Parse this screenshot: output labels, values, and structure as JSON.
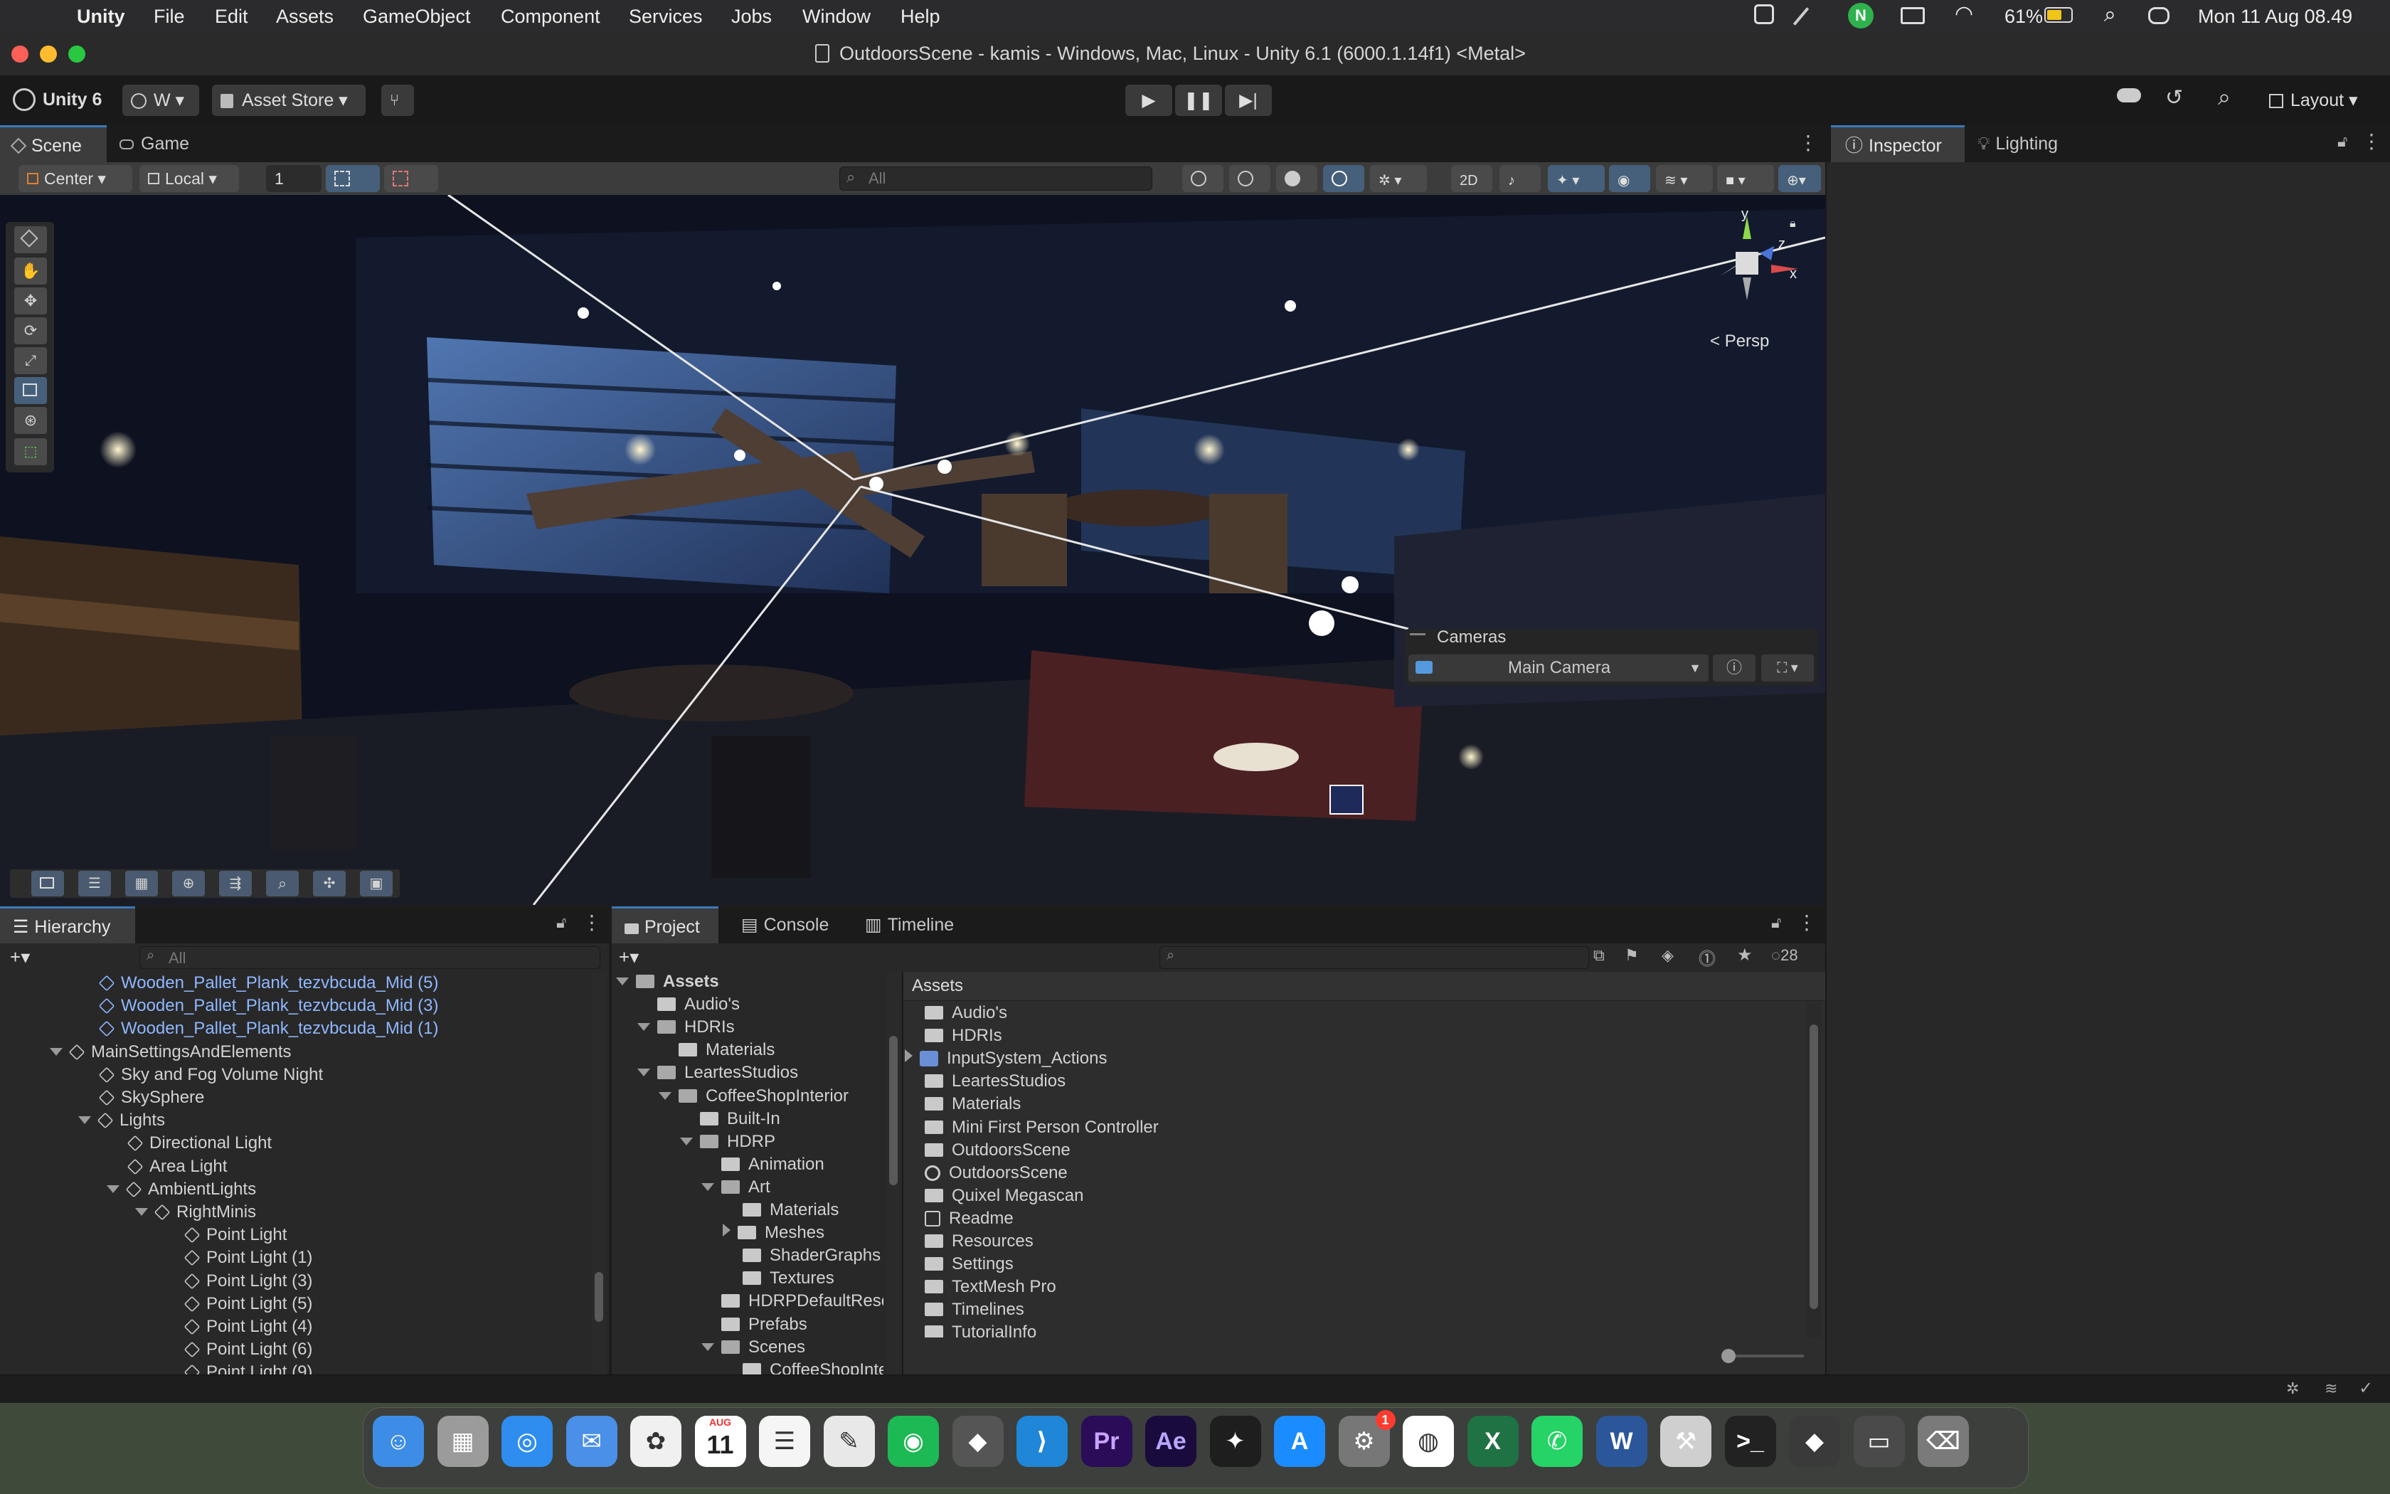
{
  "menubar": {
    "app": "Unity",
    "items": [
      "File",
      "Edit",
      "Assets",
      "GameObject",
      "Component",
      "Services",
      "Jobs",
      "Window",
      "Help"
    ],
    "battery": "61%",
    "clock": "Mon 11 Aug  08.49"
  },
  "window": {
    "title": "OutdoorsScene - kamis - Windows, Mac, Linux - Unity 6.1 (6000.1.14f1) <Metal>"
  },
  "toolbar": {
    "brand": "Unity 6",
    "account": "W",
    "asset_store": "Asset Store",
    "layout": "Layout"
  },
  "scene_tabs": {
    "scene": "Scene",
    "game": "Game"
  },
  "scene_toolbar": {
    "pivot": "Center",
    "space": "Local",
    "grid_value": "1",
    "search_placeholder": "All"
  },
  "scene_view": {
    "persp": "Persp",
    "gizmo_y": "y",
    "gizmo_x": "x",
    "gizmo_z": "z",
    "cameras_title": "Cameras",
    "camera_selected": "Main Camera"
  },
  "inspector_tabs": {
    "inspector": "Inspector",
    "lighting": "Lighting"
  },
  "hierarchy": {
    "title": "Hierarchy",
    "search_placeholder": "All",
    "rows": [
      {
        "label": "Wooden_Pallet_Plank_tezvbcuda_Mid (5)",
        "indent": 1,
        "blue": true
      },
      {
        "label": "Wooden_Pallet_Plank_tezvbcuda_Mid (3)",
        "indent": 1,
        "blue": true
      },
      {
        "label": "Wooden_Pallet_Plank_tezvbcuda_Mid (1)",
        "indent": 1,
        "blue": true
      },
      {
        "label": "MainSettingsAndElements",
        "indent": 0,
        "expanded": true
      },
      {
        "label": "Sky and Fog Volume Night",
        "indent": 1
      },
      {
        "label": "SkySphere",
        "indent": 1
      },
      {
        "label": "Lights",
        "indent": 1,
        "expanded": true
      },
      {
        "label": "Directional Light",
        "indent": 2
      },
      {
        "label": "Area Light",
        "indent": 2
      },
      {
        "label": "AmbientLights",
        "indent": 2,
        "expanded": true
      },
      {
        "label": "RightMinis",
        "indent": 3,
        "expanded": true
      },
      {
        "label": "Point Light",
        "indent": 4
      },
      {
        "label": "Point Light (1)",
        "indent": 4
      },
      {
        "label": "Point Light (3)",
        "indent": 4
      },
      {
        "label": "Point Light (5)",
        "indent": 4
      },
      {
        "label": "Point Light (4)",
        "indent": 4
      },
      {
        "label": "Point Light (6)",
        "indent": 4
      },
      {
        "label": "Point Light (9)",
        "indent": 4
      }
    ]
  },
  "project_tabs": {
    "project": "Project",
    "console": "Console",
    "timeline": "Timeline",
    "hidden_count": "28"
  },
  "project_tree": [
    {
      "label": "Assets",
      "indent": 0,
      "expanded": true,
      "bold": true
    },
    {
      "label": "Audio's",
      "indent": 1
    },
    {
      "label": "HDRIs",
      "indent": 1,
      "expanded": true
    },
    {
      "label": "Materials",
      "indent": 2
    },
    {
      "label": "LeartesStudios",
      "indent": 1,
      "expanded": true
    },
    {
      "label": "CoffeeShopInterior",
      "indent": 2,
      "expanded": true
    },
    {
      "label": "Built-In",
      "indent": 3
    },
    {
      "label": "HDRP",
      "indent": 3,
      "expanded": true
    },
    {
      "label": "Animation",
      "indent": 4
    },
    {
      "label": "Art",
      "indent": 4,
      "expanded": true
    },
    {
      "label": "Materials",
      "indent": 5
    },
    {
      "label": "Meshes",
      "indent": 5,
      "collapsed": true
    },
    {
      "label": "ShaderGraphs",
      "indent": 5
    },
    {
      "label": "Textures",
      "indent": 5
    },
    {
      "label": "HDRPDefaultReso",
      "indent": 4
    },
    {
      "label": "Prefabs",
      "indent": 4
    },
    {
      "label": "Scenes",
      "indent": 4,
      "expanded": true
    },
    {
      "label": "CoffeeShopInte",
      "indent": 5
    }
  ],
  "assets_panel": {
    "header": "Assets",
    "items": [
      {
        "label": "Audio's",
        "kind": "folder"
      },
      {
        "label": "HDRIs",
        "kind": "folder"
      },
      {
        "label": "InputSystem_Actions",
        "kind": "input-actions"
      },
      {
        "label": "LeartesStudios",
        "kind": "folder"
      },
      {
        "label": "Materials",
        "kind": "folder"
      },
      {
        "label": "Mini First Person Controller",
        "kind": "folder"
      },
      {
        "label": "OutdoorsScene",
        "kind": "folder"
      },
      {
        "label": "OutdoorsScene",
        "kind": "scene"
      },
      {
        "label": "Quixel Megascan",
        "kind": "folder"
      },
      {
        "label": "Readme",
        "kind": "readme"
      },
      {
        "label": "Resources",
        "kind": "folder"
      },
      {
        "label": "Settings",
        "kind": "folder"
      },
      {
        "label": "TextMesh Pro",
        "kind": "folder"
      },
      {
        "label": "Timelines",
        "kind": "folder"
      },
      {
        "label": "TutorialInfo",
        "kind": "folder"
      }
    ]
  },
  "dock": {
    "calendar_month": "AUG",
    "calendar_day": "11",
    "settings_badge": "1",
    "icons": [
      "finder",
      "launchpad",
      "safari",
      "mail",
      "photos",
      "calendar",
      "reminders",
      "freeform",
      "spotify",
      "unity-hub",
      "vscode",
      "premiere",
      "after-effects",
      "figma",
      "app-store",
      "system-settings",
      "chrome",
      "excel",
      "whatsapp",
      "word",
      "utility",
      "terminal",
      "unity6",
      "finder-window",
      "trash"
    ],
    "labels": {
      "premiere": "Pr",
      "after_effects": "Ae",
      "excel": "X",
      "word": "W"
    }
  },
  "colors": {
    "accent_blue": "#3a79bb",
    "selection_blue": "#8fb7ff",
    "panel_dark": "#282828",
    "panel_mid": "#3c3c3c"
  }
}
